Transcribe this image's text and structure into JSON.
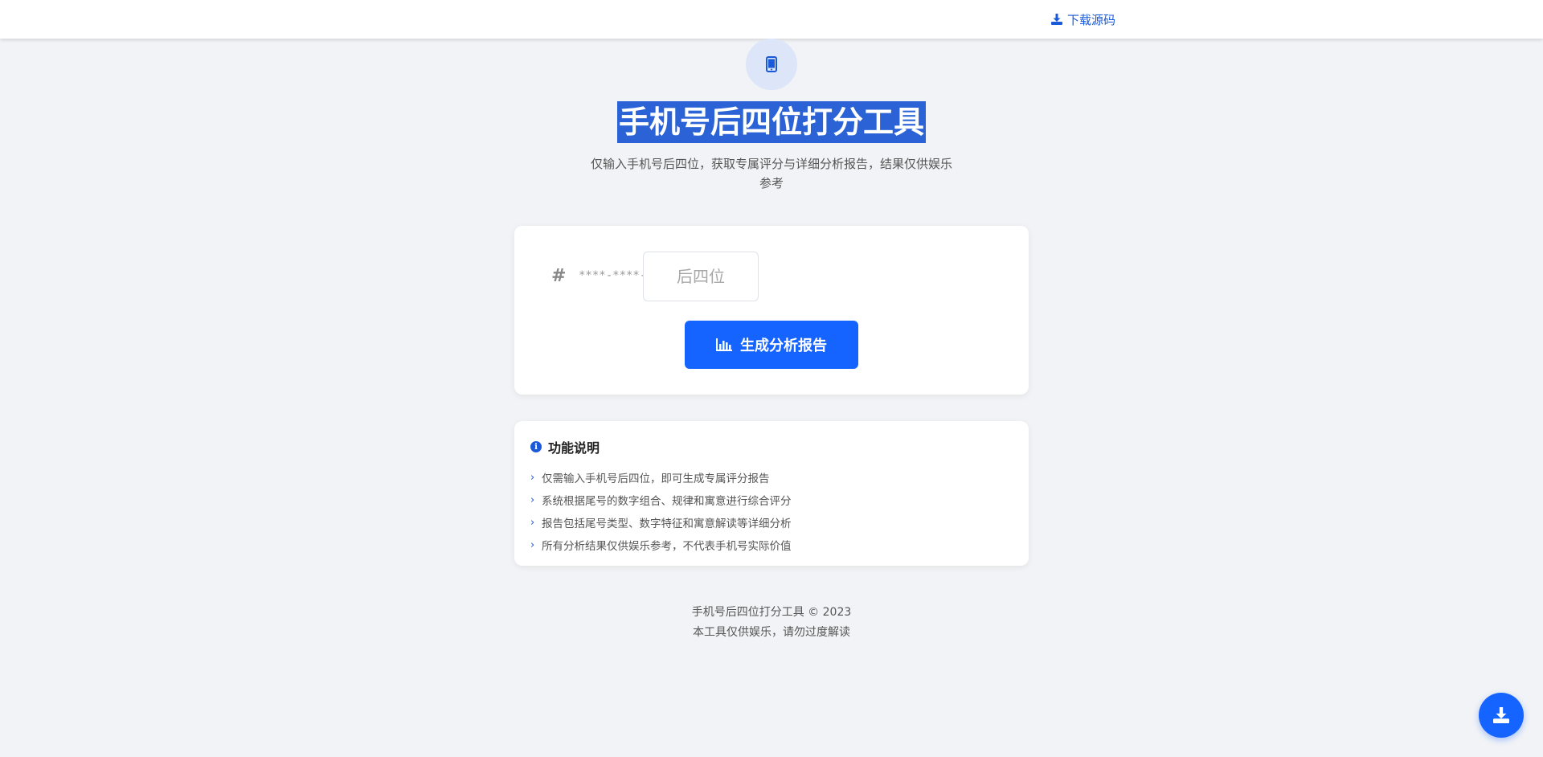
{
  "header": {
    "download_label": "下载源码",
    "download_icon": "download-icon"
  },
  "hero": {
    "icon": "mobile-phone-icon",
    "title": "手机号后四位打分工具",
    "subtitle": "仅输入手机号后四位，获取专属评分与详细分析报告，结果仅供娱乐参考"
  },
  "form": {
    "prefix_icon": "hash-icon",
    "prefix_mask": "****-****-",
    "input_value": "",
    "input_placeholder": "后四位",
    "submit_label": "生成分析报告",
    "submit_icon": "bar-chart-icon"
  },
  "info": {
    "icon": "info-circle-icon",
    "title": "功能说明",
    "items": [
      "仅需输入手机号后四位，即可生成专属评分报告",
      "系统根据尾号的数字组合、规律和寓意进行综合评分",
      "报告包括尾号类型、数字特征和寓意解读等详细分析",
      "所有分析结果仅供娱乐参考，不代表手机号实际价值"
    ]
  },
  "footer": {
    "line1": "手机号后四位打分工具 © 2023",
    "line2": "本工具仅供娱乐，请勿过度解读"
  },
  "fab": {
    "icon": "download-icon"
  },
  "colors": {
    "accent": "#1664ff",
    "link": "#1a5ad8",
    "background": "#f1f3f6",
    "title_highlight": "#2b63d6"
  }
}
